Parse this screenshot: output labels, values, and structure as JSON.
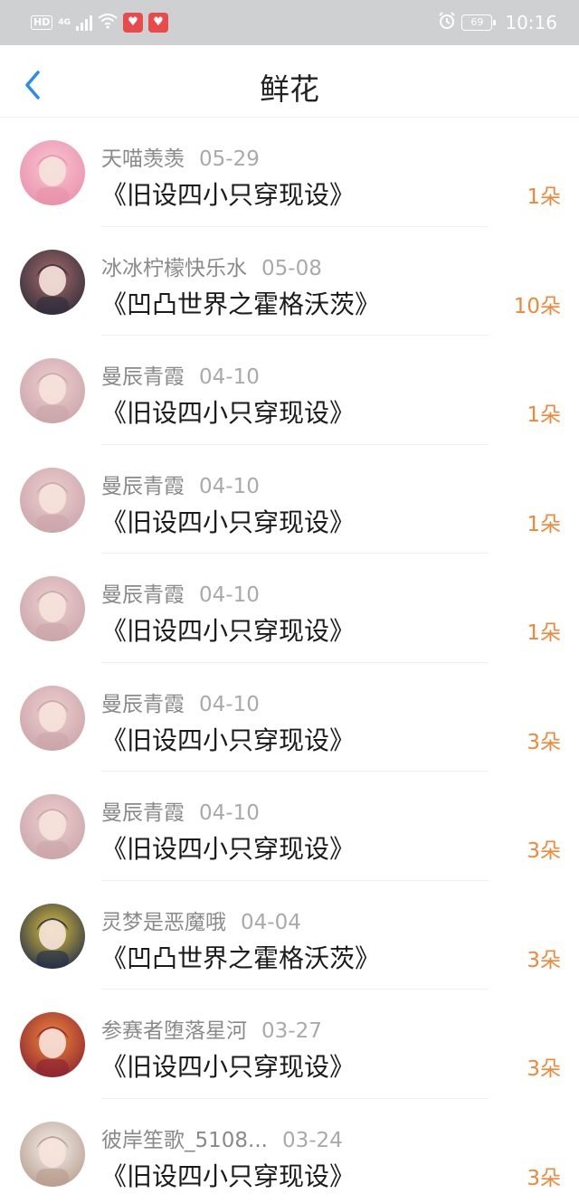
{
  "status_bar": {
    "hd": "HD",
    "network": "4G",
    "battery": "69",
    "time": "10:16"
  },
  "nav": {
    "title": "鲜花"
  },
  "colors": {
    "accent": "#2a8cf0",
    "count": "#f0883a",
    "status_bar_bg": "#cfd0d2"
  },
  "list": [
    {
      "name": "天喵羡羡",
      "date": "05-29",
      "title": "《旧设四小只穿现设》",
      "count": "1朵",
      "avatar_colors": [
        "#f7c6d4",
        "#e98fa9"
      ]
    },
    {
      "name": "冰冰柠檬快乐水",
      "date": "05-08",
      "title": "《凹凸世界之霍格沃茨》",
      "count": "10朵",
      "avatar_colors": [
        "#a86b6b",
        "#2b2b38"
      ]
    },
    {
      "name": "曼辰青霞",
      "date": "04-10",
      "title": "《旧设四小只穿现设》",
      "count": "1朵",
      "avatar_colors": [
        "#eecfd0",
        "#c9a3a8"
      ]
    },
    {
      "name": "曼辰青霞",
      "date": "04-10",
      "title": "《旧设四小只穿现设》",
      "count": "1朵",
      "avatar_colors": [
        "#eecfd0",
        "#c9a3a8"
      ]
    },
    {
      "name": "曼辰青霞",
      "date": "04-10",
      "title": "《旧设四小只穿现设》",
      "count": "1朵",
      "avatar_colors": [
        "#eecfd0",
        "#c9a3a8"
      ]
    },
    {
      "name": "曼辰青霞",
      "date": "04-10",
      "title": "《旧设四小只穿现设》",
      "count": "3朵",
      "avatar_colors": [
        "#eecfd0",
        "#c9a3a8"
      ]
    },
    {
      "name": "曼辰青霞",
      "date": "04-10",
      "title": "《旧设四小只穿现设》",
      "count": "3朵",
      "avatar_colors": [
        "#eecfd0",
        "#c9a3a8"
      ]
    },
    {
      "name": "灵梦是恶魔哦",
      "date": "04-04",
      "title": "《凹凸世界之霍格沃茨》",
      "count": "3朵",
      "avatar_colors": [
        "#e0c23a",
        "#1d2a4a"
      ]
    },
    {
      "name": "参赛者堕落星河",
      "date": "03-27",
      "title": "《旧设四小只穿现设》",
      "count": "3朵",
      "avatar_colors": [
        "#f08a3a",
        "#8a2030"
      ]
    },
    {
      "name": "彼岸笙歌_5108...",
      "date": "03-24",
      "title": "《旧设四小只穿现设》",
      "count": "3朵",
      "avatar_colors": [
        "#f2f2f0",
        "#b89a8a"
      ]
    }
  ]
}
